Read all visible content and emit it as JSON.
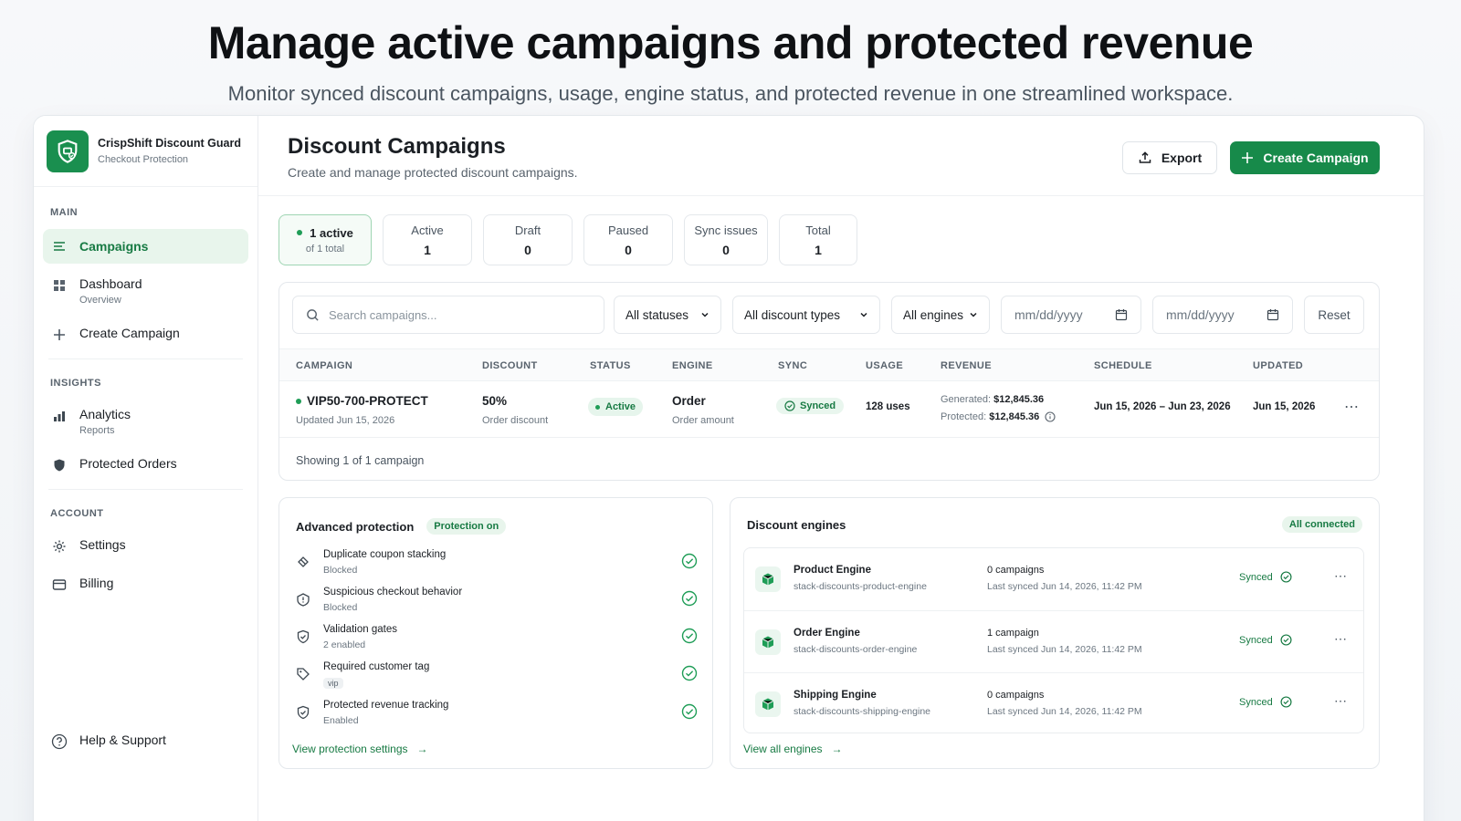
{
  "hero": {
    "title": "Manage active campaigns and protected revenue",
    "subtitle": "Monitor synced discount campaigns, usage, engine status, and protected revenue in one streamlined workspace."
  },
  "brand": {
    "name": "CrispShift Discount Guard",
    "sub": "Checkout Protection",
    "color": "#1a8f4f"
  },
  "sidebar": {
    "sections": {
      "main": "MAIN",
      "insights": "INSIGHTS",
      "account": "ACCOUNT"
    },
    "items": {
      "campaigns": {
        "label": "Campaigns"
      },
      "dashboard": {
        "label": "Dashboard",
        "sub": "Overview"
      },
      "create": {
        "label": "Create Campaign"
      },
      "analytics": {
        "label": "Analytics",
        "sub": "Reports"
      },
      "protected": {
        "label": "Protected Orders"
      },
      "settings": {
        "label": "Settings"
      },
      "billing": {
        "label": "Billing"
      },
      "help": {
        "label": "Help & Support"
      }
    }
  },
  "header": {
    "title": "Discount Campaigns",
    "subtitle": "Create and manage protected discount campaigns.",
    "export_label": "Export",
    "create_label": "Create Campaign"
  },
  "stats": {
    "summary": {
      "label": "1 active",
      "sub": "of 1 total"
    },
    "active": {
      "label": "Active",
      "value": "1"
    },
    "draft": {
      "label": "Draft",
      "value": "0"
    },
    "paused": {
      "label": "Paused",
      "value": "0"
    },
    "sync": {
      "label": "Sync issues",
      "value": "0"
    },
    "total": {
      "label": "Total",
      "value": "1"
    }
  },
  "filters": {
    "search_placeholder": "Search campaigns...",
    "status": "All statuses",
    "types": "All discount types",
    "engines": "All engines",
    "date_from": "mm/dd/yyyy",
    "date_to": "mm/dd/yyyy",
    "reset": "Reset"
  },
  "table": {
    "columns": [
      "CAMPAIGN",
      "DISCOUNT",
      "STATUS",
      "ENGINE",
      "SYNC",
      "USAGE",
      "REVENUE",
      "SCHEDULE",
      "UPDATED"
    ],
    "rows": [
      {
        "name": "VIP50-700-PROTECT",
        "updated_sub": "Updated Jun 15, 2026",
        "discount": "50%",
        "discount_type": "Order discount",
        "status": "Active",
        "engine": "Order",
        "engine_sub": "Order amount",
        "sync": "Synced",
        "usage": "128 uses",
        "generated_label": "Generated:",
        "generated": "$12,845.36",
        "protected_label": "Protected:",
        "protected": "$12,845.36",
        "schedule": "Jun 15, 2026 – Jun 23, 2026",
        "updated": "Jun 15, 2026"
      }
    ],
    "showing": "Showing 1 of 1 campaign"
  },
  "protection": {
    "title": "Advanced protection",
    "badge": "Protection on",
    "items": [
      {
        "title": "Duplicate coupon stacking",
        "sub": "Blocked"
      },
      {
        "title": "Suspicious checkout behavior",
        "sub": "Blocked"
      },
      {
        "title": "Validation gates",
        "sub": "2 enabled"
      },
      {
        "title": "Required customer tag",
        "sub": "vip"
      },
      {
        "title": "Protected revenue tracking",
        "sub": "Enabled"
      }
    ],
    "link": "View protection settings"
  },
  "engines": {
    "title": "Discount engines",
    "badge": "All connected",
    "items": [
      {
        "name": "Product Engine",
        "slug": "stack-discounts-product-engine",
        "campaigns": "0 campaigns",
        "last": "Last synced Jun 14, 2026, 11:42 PM",
        "sync": "Synced"
      },
      {
        "name": "Order Engine",
        "slug": "stack-discounts-order-engine",
        "campaigns": "1 campaign",
        "last": "Last synced Jun 14, 2026, 11:42 PM",
        "sync": "Synced"
      },
      {
        "name": "Shipping Engine",
        "slug": "stack-discounts-shipping-engine",
        "campaigns": "0 campaigns",
        "last": "Last synced Jun 14, 2026, 11:42 PM",
        "sync": "Synced"
      }
    ],
    "link": "View all engines"
  }
}
